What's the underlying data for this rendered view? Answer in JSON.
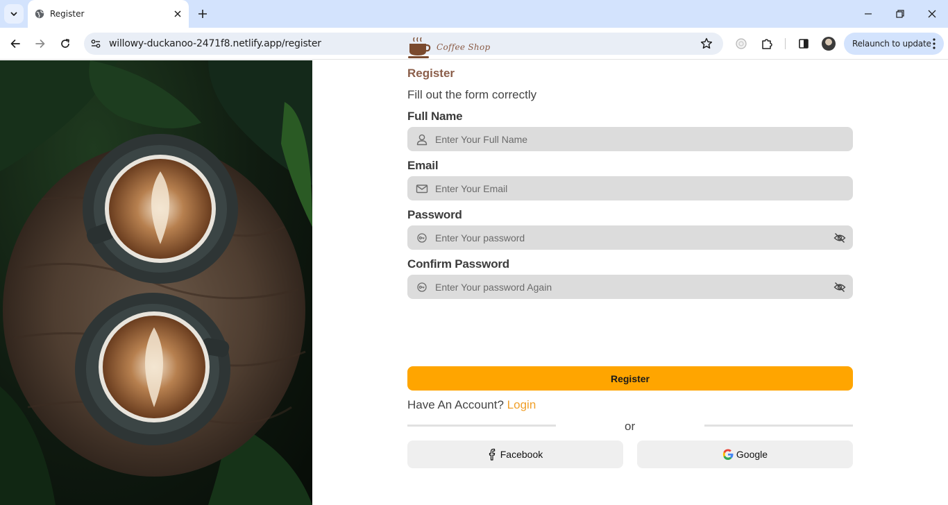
{
  "browser": {
    "tab_title": "Register",
    "url": "willowy-duckanoo-2471f8.netlify.app/register",
    "relaunch_label": "Relaunch to update"
  },
  "page": {
    "brand": "Coffee Shop",
    "heading": "Register",
    "subtitle": "Fill out the form correctly",
    "fields": [
      {
        "label": "Full Name",
        "placeholder": "Enter Your Full Name",
        "icon": "user-icon"
      },
      {
        "label": "Email",
        "placeholder": "Enter Your Email",
        "icon": "mail-icon"
      },
      {
        "label": "Password",
        "placeholder": "Enter Your password",
        "icon": "key-icon"
      },
      {
        "label": "Confirm Password",
        "placeholder": "Enter Your password Again",
        "icon": "key-icon"
      }
    ],
    "register_button": "Register",
    "have_account": "Have An Account?",
    "login_link": "Login",
    "or": "or",
    "facebook": "Facebook",
    "google": "Google"
  },
  "colors": {
    "accent": "#ffa500",
    "brand": "#8b5e4a",
    "link": "#f0a02a",
    "field_bg": "#dcdcdc"
  }
}
